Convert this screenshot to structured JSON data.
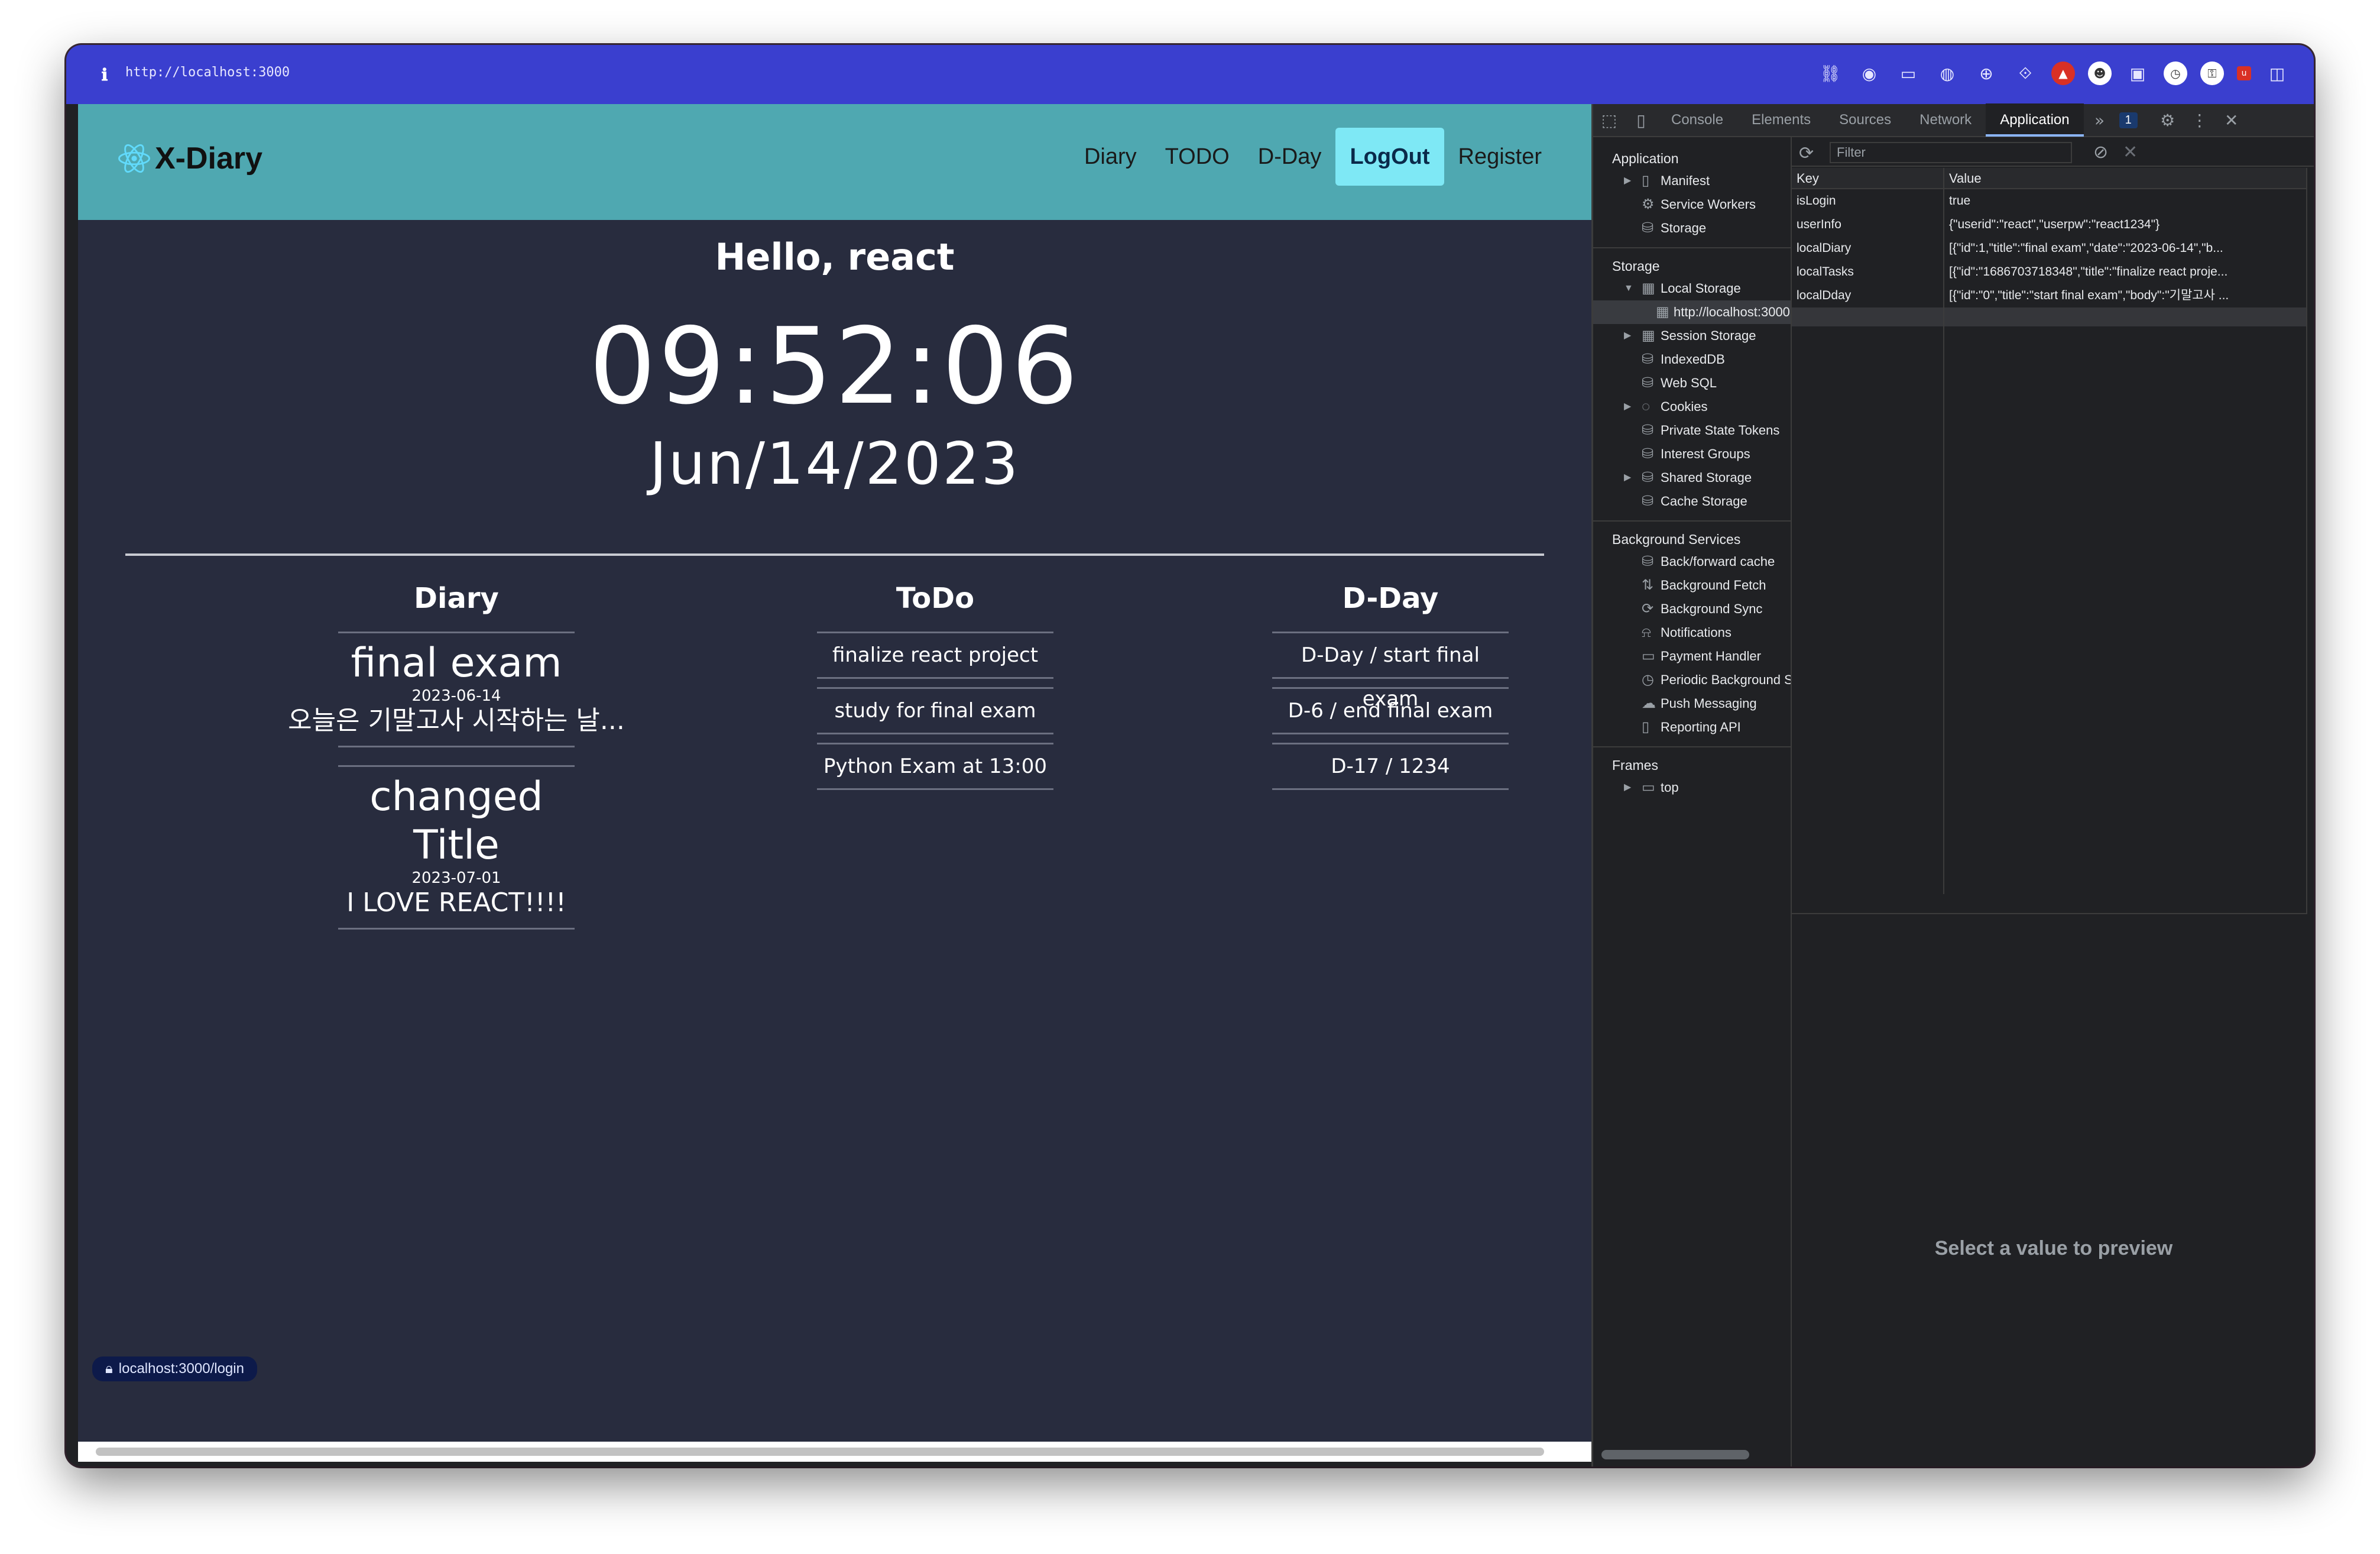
{
  "browser": {
    "url": "http://localhost:3000",
    "info_icon": "ℹ",
    "toolbar_icons": [
      "link-icon",
      "camera-icon",
      "terminal-icon",
      "globe-icon",
      "crosshair-icon",
      "extension-icon",
      "brave-icon",
      "ghost-icon",
      "window-icon",
      "clock-icon",
      "lock-icon",
      "ublock-icon",
      "sidebar-icon"
    ]
  },
  "app": {
    "logo_text": "X-Diary",
    "nav": [
      "Diary",
      "TODO",
      "D-Day",
      "LogOut",
      "Register"
    ],
    "active_nav": "LogOut",
    "greeting": "Hello, react",
    "time": "09:52:06",
    "date": "Jun/14/2023",
    "columns": {
      "diary": {
        "title": "Diary",
        "entries": [
          {
            "title": "final exam",
            "date": "2023-06-14",
            "body": "오늘은 기말고사 시작하는 날..."
          },
          {
            "title": "changed Title",
            "date": "2023-07-01",
            "body": "I LOVE REACT!!!!"
          }
        ]
      },
      "todo": {
        "title": "ToDo",
        "items": [
          "finalize react project",
          "study for final exam",
          "Python Exam at 13:00"
        ]
      },
      "dday": {
        "title": "D-Day",
        "items": [
          "D-Day / start final exam",
          "D-6 / end final exam",
          "D-17 / 1234"
        ]
      }
    },
    "status_link": "localhost:3000/login"
  },
  "devtools": {
    "tabs": [
      "Console",
      "Elements",
      "Sources",
      "Network",
      "Application"
    ],
    "active_tab": "Application",
    "issue_count": "1",
    "sidebar": {
      "application_header": "Application",
      "application_items": [
        "Manifest",
        "Service Workers",
        "Storage"
      ],
      "storage_header": "Storage",
      "storage_items": [
        "Local Storage",
        "http://localhost:3000",
        "Session Storage",
        "IndexedDB",
        "Web SQL",
        "Cookies",
        "Private State Tokens",
        "Interest Groups",
        "Shared Storage",
        "Cache Storage"
      ],
      "background_header": "Background Services",
      "background_items": [
        "Back/forward cache",
        "Background Fetch",
        "Background Sync",
        "Notifications",
        "Payment Handler",
        "Periodic Background Sync",
        "Push Messaging",
        "Reporting API"
      ],
      "frames_header": "Frames",
      "frames_items": [
        "top"
      ]
    },
    "filter_placeholder": "Filter",
    "table": {
      "key_header": "Key",
      "value_header": "Value",
      "rows": [
        {
          "key": "isLogin",
          "value": "true"
        },
        {
          "key": "userInfo",
          "value": "{\"userid\":\"react\",\"userpw\":\"react1234\"}"
        },
        {
          "key": "localDiary",
          "value": "[{\"id\":1,\"title\":\"final exam\",\"date\":\"2023-06-14\",\"b..."
        },
        {
          "key": "localTasks",
          "value": "[{\"id\":\"1686703718348\",\"title\":\"finalize react proje..."
        },
        {
          "key": "localDday",
          "value": "[{\"id\":\"0\",\"title\":\"start final exam\",\"body\":\"기말고사 ..."
        }
      ]
    },
    "preview_text": "Select a value to preview"
  }
}
